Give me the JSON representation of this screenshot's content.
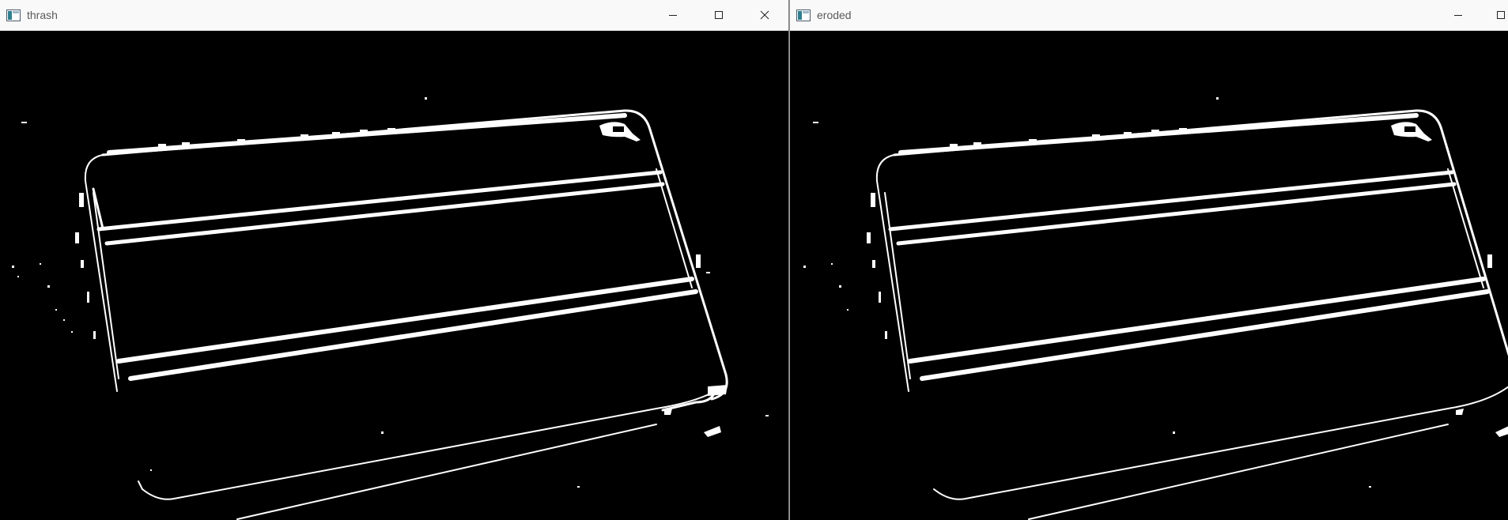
{
  "windows": [
    {
      "title": "thrash"
    },
    {
      "title": "eroded"
    }
  ],
  "colors": {
    "image_background": "#000000",
    "edge_pixels": "#ffffff",
    "titlebar": "#f9f9f9",
    "title_text": "#5a5a5a"
  },
  "icons": [
    "app-window-icon",
    "minimize-icon",
    "maximize-icon",
    "close-icon"
  ]
}
